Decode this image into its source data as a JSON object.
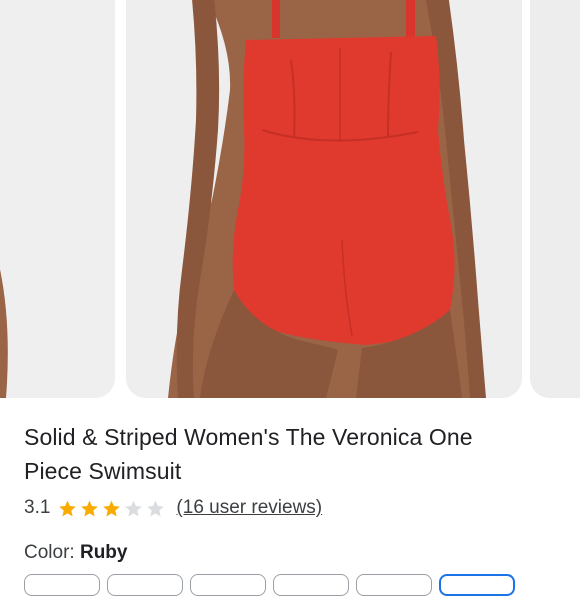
{
  "product": {
    "title_line1": "Solid & Striped Women's The Veronica One",
    "title_line2": "Piece Swimsuit",
    "rating_value": "3.1",
    "rating_stars": 3,
    "rating_max": 5,
    "reviews_link": "(16 user reviews)",
    "color_label": "Color:",
    "color_value": "Ruby"
  },
  "swatches": {
    "count": 6,
    "selected_index": 5
  },
  "colors": {
    "swimsuit": "#e03a2f",
    "skin": "#9a6447",
    "star_filled": "#f9ab00",
    "star_empty": "#dadce0",
    "selected_border": "#1a73e8"
  }
}
